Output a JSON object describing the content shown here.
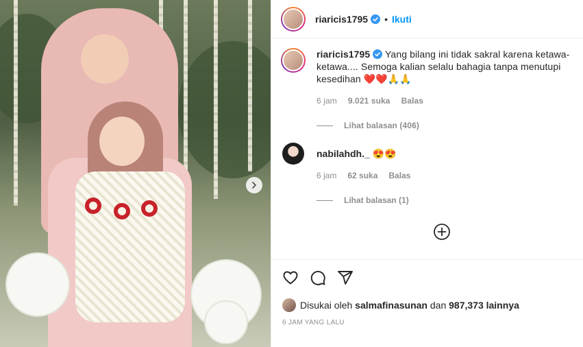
{
  "post": {
    "username": "riaricis1795",
    "follow_label": "Ikuti",
    "dot": "•"
  },
  "caption": {
    "username": "riaricis1795",
    "text": "Yang bilang ini tidak sakral karena ketawa-ketawa.... Semoga kalian selalu bahagia tanpa menutupi kesedihan ❤️❤️🙏🙏",
    "time": "6 jam",
    "likes": "9.021 suka",
    "reply": "Balas",
    "view_replies": "Lihat balasan (406)"
  },
  "comment": {
    "username": "nabilahdh._",
    "text": "😍😍",
    "time": "6 jam",
    "likes": "62 suka",
    "reply": "Balas",
    "view_replies": "Lihat balasan (1)"
  },
  "likes": {
    "prefix": "Disukai oleh",
    "user": "salmafinasunan",
    "middle": "dan",
    "others": "987,373 lainnya"
  },
  "posted": "6 JAM YANG LALU",
  "icons": [
    "verified-icon",
    "heart-icon",
    "comment-icon",
    "share-icon",
    "add-circle-icon",
    "chevron-right-icon"
  ],
  "colors": {
    "link": "#0095f6",
    "muted": "#8e8e8e",
    "text": "#262626"
  }
}
